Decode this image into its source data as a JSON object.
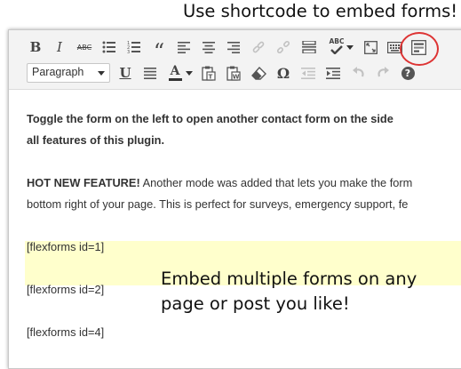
{
  "annotations": {
    "top_caption": "Use shortcode to embed forms!",
    "middle_caption_line1": "Embed multiple forms on any",
    "middle_caption_line2": "page or post you like!",
    "callout_color": "#dd3333"
  },
  "toolbar": {
    "row1": [
      {
        "name": "bold-button",
        "glyph": "B",
        "icon": "bold-icon"
      },
      {
        "name": "italic-button",
        "glyph": "I",
        "icon": "italic-icon"
      },
      {
        "name": "strikethrough-button",
        "glyph": "ABC",
        "icon": "strikethrough-icon"
      },
      {
        "name": "bullet-list-button",
        "icon": "bullet-list-icon"
      },
      {
        "name": "numbered-list-button",
        "icon": "numbered-list-icon"
      },
      {
        "name": "blockquote-button",
        "glyph": "“",
        "icon": "blockquote-icon"
      },
      {
        "name": "align-left-button",
        "icon": "align-left-icon"
      },
      {
        "name": "align-center-button",
        "icon": "align-center-icon"
      },
      {
        "name": "align-right-button",
        "icon": "align-right-icon"
      },
      {
        "name": "insert-link-button",
        "icon": "link-icon"
      },
      {
        "name": "remove-link-button",
        "icon": "unlink-icon"
      },
      {
        "name": "insert-more-button",
        "icon": "read-more-icon"
      },
      {
        "name": "spellcheck-button",
        "glyph": "ABC",
        "icon": "spellcheck-icon"
      },
      {
        "name": "fullscreen-button",
        "icon": "fullscreen-icon"
      },
      {
        "name": "kitchen-sink-button",
        "icon": "keyboard-icon"
      },
      {
        "name": "flexforms-button",
        "icon": "form-icon"
      }
    ],
    "row2": {
      "format_select": "Paragraph",
      "buttons": [
        {
          "name": "underline-button",
          "glyph": "U",
          "icon": "underline-icon"
        },
        {
          "name": "justify-button",
          "icon": "align-justify-icon"
        },
        {
          "name": "text-color-button",
          "glyph": "A",
          "icon": "text-color-icon"
        },
        {
          "name": "paste-text-button",
          "icon": "paste-text-icon"
        },
        {
          "name": "paste-word-button",
          "icon": "paste-word-icon"
        },
        {
          "name": "clear-formatting-button",
          "icon": "eraser-icon"
        },
        {
          "name": "special-character-button",
          "glyph": "Ω",
          "icon": "omega-icon"
        },
        {
          "name": "outdent-button",
          "icon": "outdent-icon"
        },
        {
          "name": "indent-button",
          "icon": "indent-icon"
        },
        {
          "name": "undo-button",
          "icon": "undo-icon"
        },
        {
          "name": "redo-button",
          "icon": "redo-icon"
        },
        {
          "name": "help-button",
          "glyph": "?",
          "icon": "help-icon"
        }
      ]
    }
  },
  "content": {
    "intro_line1": "Toggle the form on the left to open another contact form on the side",
    "intro_line2": "all features of this plugin.",
    "feature_label": "HOT NEW FEATURE!",
    "feature_line1": " Another mode was added that lets you make the form",
    "feature_line2": "bottom right of your page. This is perfect for surveys, emergency support, fe",
    "highlight_color": "#ffffcc",
    "shortcodes": [
      "[flexforms id=1]",
      "[flexforms id=2]",
      "[flexforms id=4]"
    ]
  }
}
